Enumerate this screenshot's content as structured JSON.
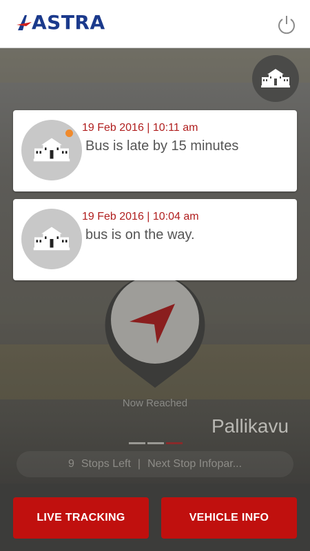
{
  "app": {
    "logo_text": "ASTRA",
    "brand_color": "#1b3a8c",
    "accent_color": "#c0100e"
  },
  "header": {
    "power_icon": "power-icon"
  },
  "fab": {
    "icon": "school-icon"
  },
  "notifications": [
    {
      "time": "19 Feb 2016 | 10:11 am",
      "message": "Bus is late by 15 minutes",
      "unread": true
    },
    {
      "time": "19 Feb 2016 | 10:04 am",
      "message": "bus is on the way."
    }
  ],
  "tracking": {
    "status_label": "Now Reached",
    "station": "Pallikavu",
    "stops_count": "9",
    "stops_label": "Stops Left",
    "separator": "|",
    "next_stop": "Next Stop  Infopar..."
  },
  "footer": {
    "live_tracking": "LIVE TRACKING",
    "vehicle_info": "VEHICLE INFO"
  }
}
